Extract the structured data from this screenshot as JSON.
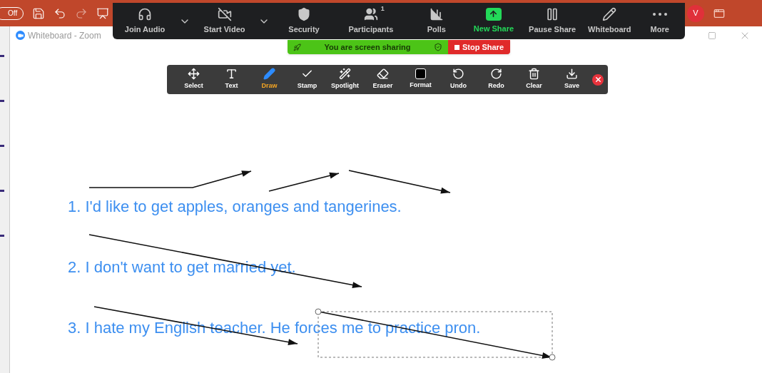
{
  "app_bar": {
    "toggle": "Off",
    "avatar": "V"
  },
  "window": {
    "title": "Whiteboard - Zoom"
  },
  "meeting_controls": [
    {
      "label": "Join Audio",
      "highlighted": false,
      "has_menu": true
    },
    {
      "label": "Start Video",
      "highlighted": false,
      "has_menu": true
    },
    {
      "label": "Security",
      "highlighted": false,
      "has_menu": false
    },
    {
      "label": "Participants",
      "highlighted": false,
      "has_menu": false,
      "badge": "1"
    },
    {
      "label": "Polls",
      "highlighted": false,
      "has_menu": false
    },
    {
      "label": "New Share",
      "highlighted": true,
      "has_menu": false
    },
    {
      "label": "Pause Share",
      "highlighted": false,
      "has_menu": false
    },
    {
      "label": "Whiteboard",
      "highlighted": false,
      "has_menu": false
    },
    {
      "label": "More",
      "highlighted": false,
      "has_menu": false
    }
  ],
  "sharing_banner": {
    "message": "You are screen sharing",
    "stop_label": "Stop Share"
  },
  "annotation_tools": [
    {
      "label": "Select",
      "selected": false
    },
    {
      "label": "Text",
      "selected": false
    },
    {
      "label": "Draw",
      "selected": true
    },
    {
      "label": "Stamp",
      "selected": false
    },
    {
      "label": "Spotlight",
      "selected": false
    },
    {
      "label": "Eraser",
      "selected": false
    },
    {
      "label": "Format",
      "selected": false
    },
    {
      "label": "Undo",
      "selected": false
    },
    {
      "label": "Redo",
      "selected": false
    },
    {
      "label": "Clear",
      "selected": false
    },
    {
      "label": "Save",
      "selected": false
    }
  ],
  "sentences": [
    "1. I'd like to get apples, oranges and tangerines.",
    "2. I don't want to get married yet.",
    "3. I hate my English teacher. He forces me to practice pron."
  ]
}
